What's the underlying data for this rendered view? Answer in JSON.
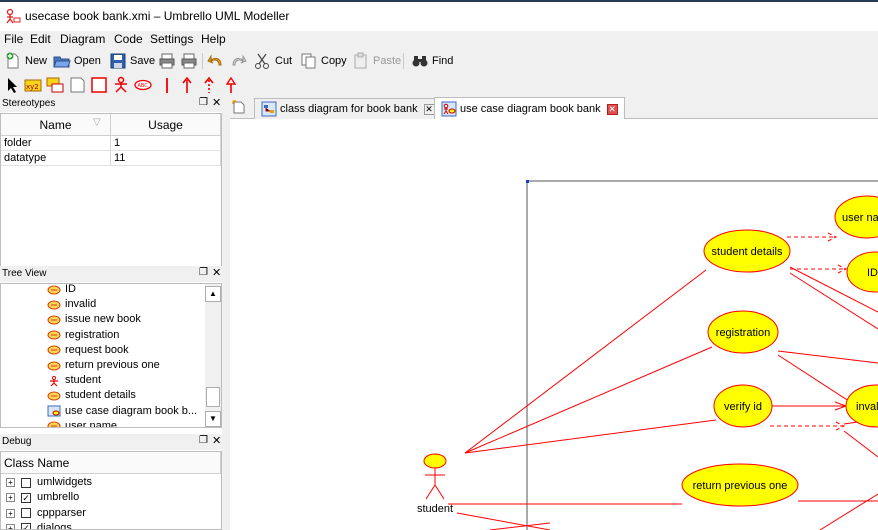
{
  "window": {
    "title": "usecase book bank.xmi – Umbrello UML Modeller"
  },
  "menu": [
    "File",
    "Edit",
    "Diagram",
    "Code",
    "Settings",
    "Help"
  ],
  "toolbar": {
    "new": "New",
    "open": "Open",
    "save": "Save",
    "cut": "Cut",
    "copy": "Copy",
    "paste": "Paste",
    "find": "Find"
  },
  "stereotypes": {
    "title": "Stereotypes",
    "columns": [
      "Name",
      "Usage"
    ],
    "rows": [
      {
        "name": "folder",
        "usage": "1"
      },
      {
        "name": "datatype",
        "usage": "11"
      }
    ]
  },
  "treeview": {
    "title": "Tree View",
    "items": [
      {
        "label": "ID",
        "icon": "usecase-icon"
      },
      {
        "label": "invalid",
        "icon": "usecase-icon"
      },
      {
        "label": "issue new book",
        "icon": "usecase-icon"
      },
      {
        "label": "registration",
        "icon": "usecase-icon"
      },
      {
        "label": "request book",
        "icon": "usecase-icon"
      },
      {
        "label": "return previous one",
        "icon": "usecase-icon"
      },
      {
        "label": "student",
        "icon": "actor-icon"
      },
      {
        "label": "student details",
        "icon": "usecase-icon"
      },
      {
        "label": "use case diagram book b...",
        "icon": "diagram-icon"
      },
      {
        "label": "user name",
        "icon": "usecase-icon"
      }
    ]
  },
  "debug": {
    "title": "Debug",
    "header": "Class Name",
    "rows": [
      {
        "label": "umlwidgets",
        "checked": false
      },
      {
        "label": "umbrello",
        "checked": true
      },
      {
        "label": "cppparser",
        "checked": false
      },
      {
        "label": "dialogs",
        "checked": true
      }
    ]
  },
  "tabs": [
    {
      "label": "class diagram for book bank",
      "active": false
    },
    {
      "label": "use case diagram book bank",
      "active": true
    }
  ],
  "diagram": {
    "actor": "student",
    "usecases": [
      "user name",
      "student details",
      "ID",
      "registration",
      "verify id",
      "invalid",
      "return previous one"
    ]
  },
  "colors": {
    "usecase_fill": "#ffff00",
    "line": "#ff0000",
    "accent": "#2b3a55"
  }
}
